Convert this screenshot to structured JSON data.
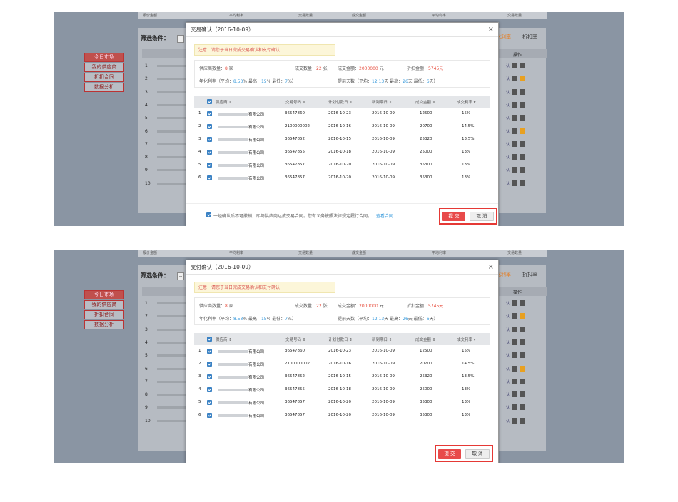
{
  "background": {
    "top_labels": [
      "报价金额",
      "平均利率",
      "交易数量",
      "成交金额",
      "平均利率",
      "交易数量"
    ],
    "filter_label": "筛选条件：",
    "filter_select": "--",
    "sidebar": [
      "今日市场",
      "我的供应商",
      "折扣合同",
      "数据分析"
    ],
    "right_tabs": [
      "化利率",
      "折扣率"
    ],
    "op_header": "操作",
    "row_numbers": [
      "1",
      "2",
      "3",
      "4",
      "5",
      "6",
      "7",
      "8",
      "9",
      "10"
    ]
  },
  "dialogs": [
    {
      "title": "交易确认（2016-10-09）",
      "show_agreement": true
    },
    {
      "title": "支付确认（2016-10-09）",
      "show_agreement": false
    }
  ],
  "note": "注意：请您于当日完成交易确认和支付确认",
  "summary": {
    "supplier_count_label": "供应商数量：",
    "supplier_count": "8",
    "supplier_count_unit": "家",
    "deal_count_label": "成交数量：",
    "deal_count": "22",
    "deal_count_unit": "张",
    "deal_amount_label": "成交金额：",
    "deal_amount": "2000000",
    "deal_amount_unit": "元",
    "discount_amount_label": "折扣金额：",
    "discount_amount": "5745元",
    "rate_label": "年化利率（平均：",
    "rate_avg": "8.53",
    "rate_max_label": "%   最高：",
    "rate_max": "15",
    "rate_min_label": "%   最低：",
    "rate_min": "7",
    "rate_end": "%）",
    "days_label": "提前天数（平均：",
    "days_avg": "12.13",
    "days_max_label": "天   最高：",
    "days_max": "26",
    "days_min_label": "天   最低：",
    "days_min": "6",
    "days_end": "天）"
  },
  "table": {
    "headers": [
      "供应商 ⇕",
      "交易号码 ⇕",
      "计划付款日 ⇕",
      "新到期日 ⇕",
      "成交金额 ⇕",
      "成交利率 ▾"
    ],
    "rows": [
      {
        "idx": "1",
        "company": "有限公司",
        "no": "36547860",
        "plan": "2016-10-23",
        "due": "2016-10-09",
        "amount": "12500",
        "rate": "15%"
      },
      {
        "idx": "2",
        "company": "有限公司",
        "no": "2100000002",
        "plan": "2016-10-16",
        "due": "2016-10-09",
        "amount": "20700",
        "rate": "14.5%"
      },
      {
        "idx": "3",
        "company": "有限公司",
        "no": "36547852",
        "plan": "2016-10-15",
        "due": "2016-10-09",
        "amount": "25320",
        "rate": "13.5%"
      },
      {
        "idx": "4",
        "company": "有限公司",
        "no": "36547855",
        "plan": "2016-10-18",
        "due": "2016-10-09",
        "amount": "25000",
        "rate": "13%"
      },
      {
        "idx": "5",
        "company": "有限公司",
        "no": "36547857",
        "plan": "2016-10-20",
        "due": "2016-10-09",
        "amount": "35300",
        "rate": "13%"
      },
      {
        "idx": "6",
        "company": "有限公司",
        "no": "36547857",
        "plan": "2016-10-20",
        "due": "2016-10-09",
        "amount": "35300",
        "rate": "13%"
      }
    ]
  },
  "agreement": "一经确认后不可撤销，即与供应商达成交易合同。您有义务按照法律规定履行合同。",
  "view_contract": "查看合同",
  "submit": "提 交",
  "cancel": "取 消",
  "close": "×"
}
